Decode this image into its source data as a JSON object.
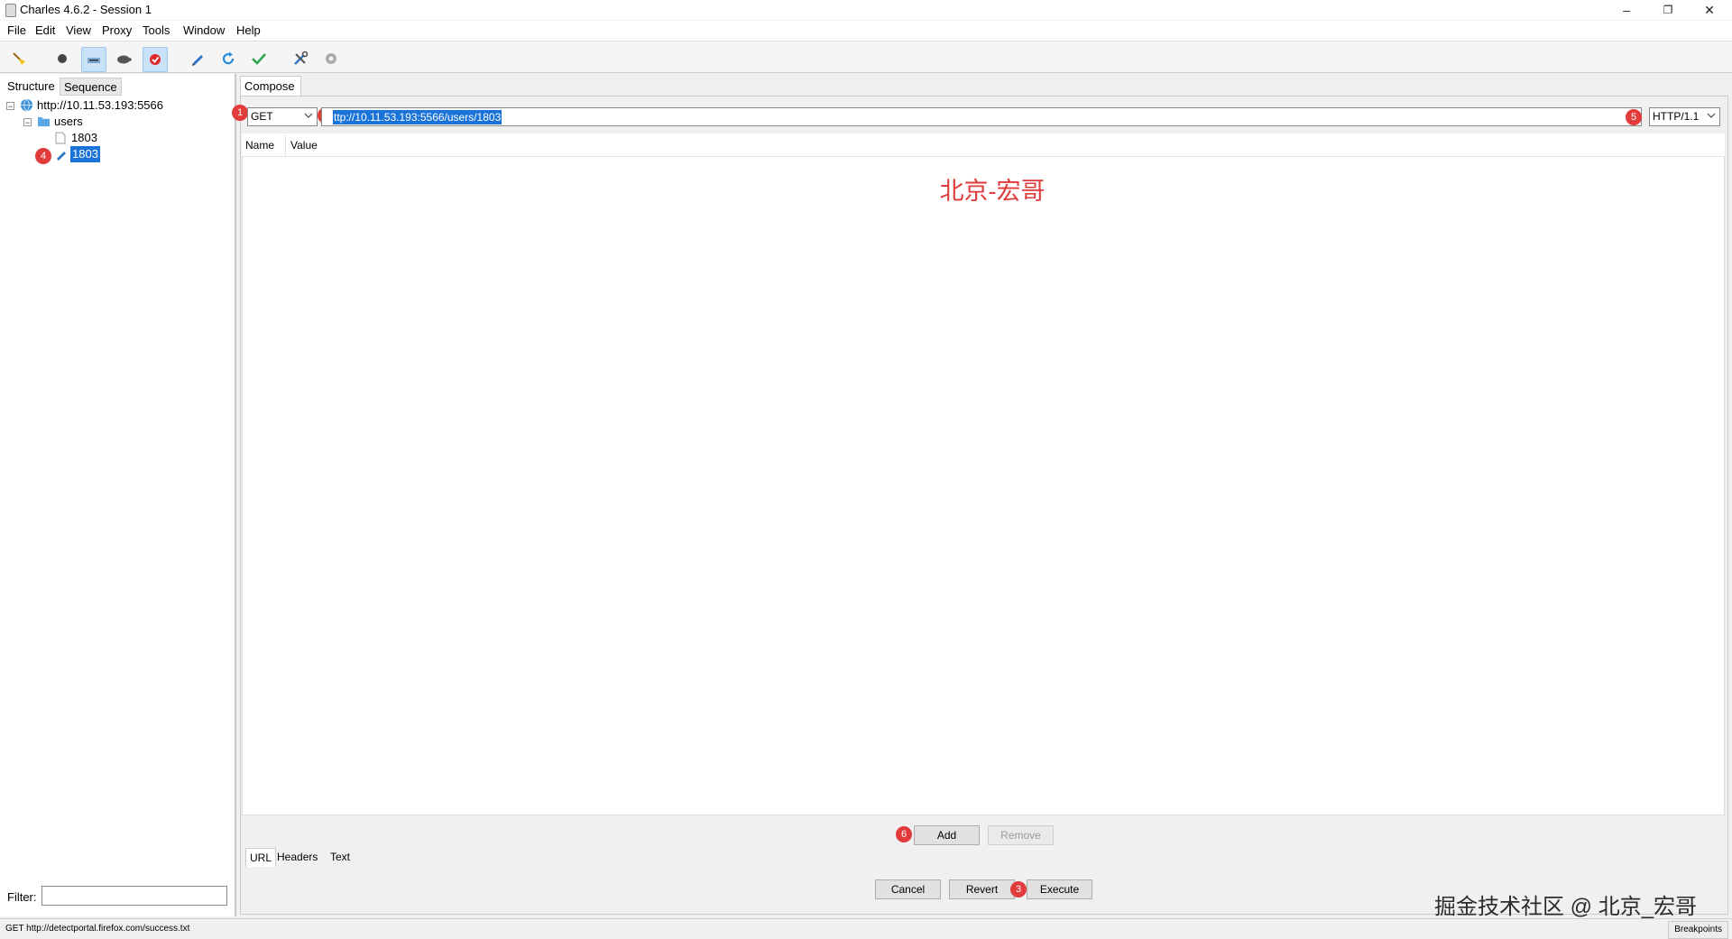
{
  "window": {
    "title": "Charles 4.6.2 - Session 1",
    "minimize": "–",
    "restore": "❐",
    "close": "✕"
  },
  "menu": [
    "File",
    "Edit",
    "View",
    "Proxy",
    "Tools",
    "Window",
    "Help"
  ],
  "toolbar": {
    "buttons": [
      {
        "name": "broom-icon",
        "active": false
      },
      {
        "name": "record-icon",
        "active": false
      },
      {
        "name": "throttle-icon",
        "active": true
      },
      {
        "name": "turtle-icon",
        "active": false
      },
      {
        "name": "breakpoints-icon",
        "active": true
      },
      {
        "name": "compose-pen-icon",
        "active": false
      },
      {
        "name": "repeat-icon",
        "active": false
      },
      {
        "name": "validate-check-icon",
        "active": false
      },
      {
        "name": "tools-icon",
        "active": false
      },
      {
        "name": "settings-gear-icon",
        "active": false
      }
    ]
  },
  "left": {
    "tabs": [
      "Structure",
      "Sequence"
    ],
    "tree": {
      "host": "http://10.11.53.193:5566",
      "folder": "users",
      "item1": "1803",
      "item2": "1803"
    },
    "filter_label": "Filter:",
    "filter_value": ""
  },
  "compose": {
    "tab": "Compose",
    "method": "GET",
    "url": "ttp://10.11.53.193:5566/users/1803",
    "protocol": "HTTP/1.1",
    "columns": [
      "Name",
      "Value"
    ],
    "watermark": "北京-宏哥",
    "add_label": "Add",
    "remove_label": "Remove",
    "bottom_tabs": [
      "URL",
      "Headers",
      "Text"
    ],
    "cancel_label": "Cancel",
    "revert_label": "Revert",
    "execute_label": "Execute"
  },
  "badges": [
    "1",
    "2",
    "3",
    "4",
    "5",
    "6"
  ],
  "bottom_watermark": "掘金技术社区 @ 北京_宏哥",
  "status": {
    "text": "GET http://detectportal.firefox.com/success.txt",
    "breakpoints": "Breakpoints"
  },
  "colors": {
    "selection": "#1a73d9",
    "badge": "#e23b3b",
    "watermark": "#e03b3b"
  }
}
